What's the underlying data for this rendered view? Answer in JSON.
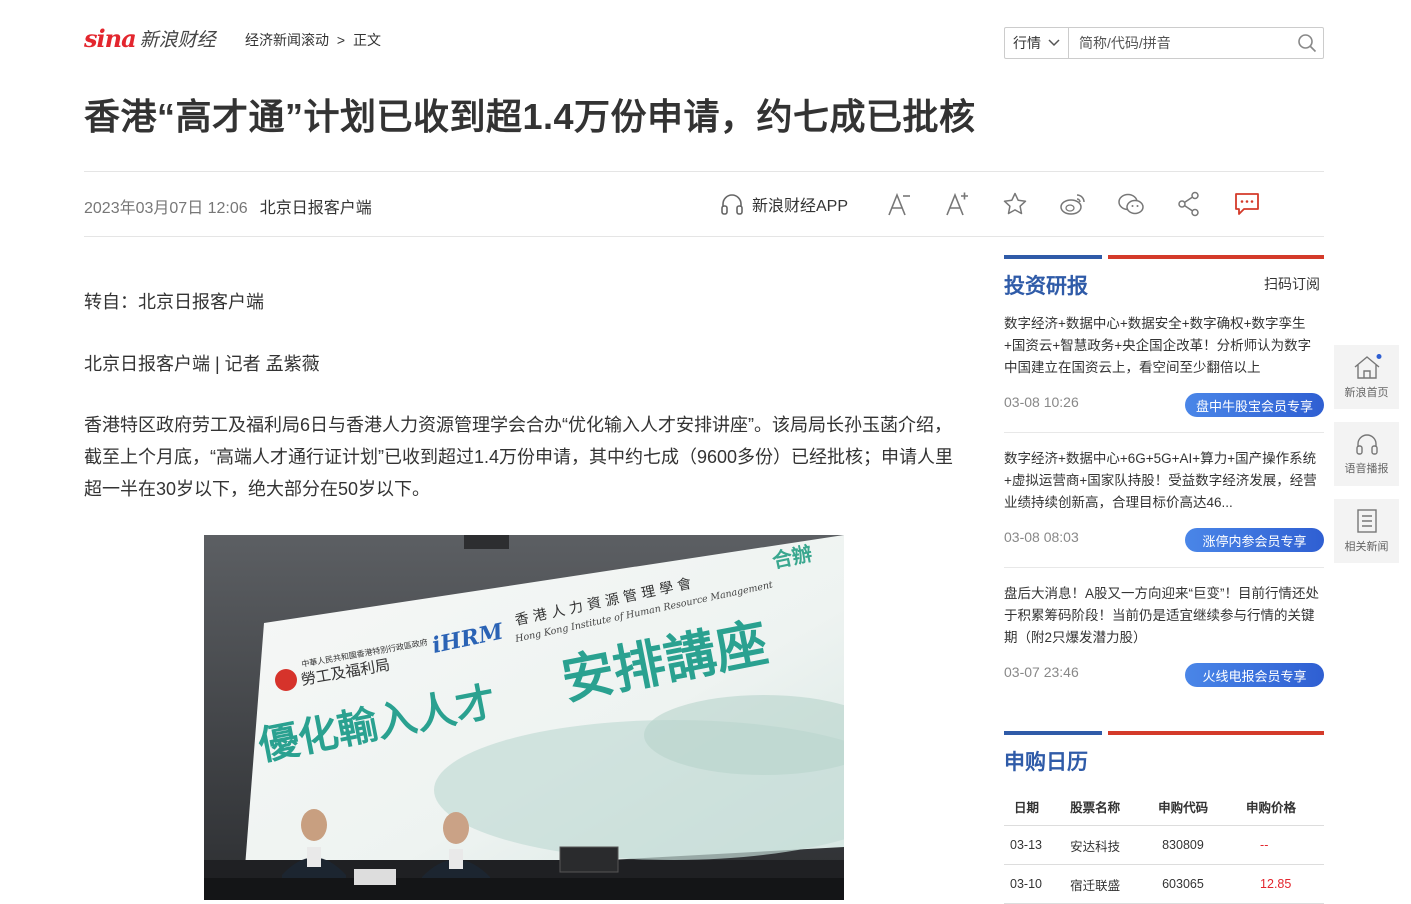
{
  "header": {
    "logo_sina": "sina",
    "logo_text": "新浪财经",
    "breadcrumb": [
      "经济新闻滚动",
      ">",
      "正文"
    ],
    "search_select": "行情",
    "search_placeholder": "简称/代码/拼音"
  },
  "article": {
    "title": "香港“高才通”计划已收到超1.4万份申请，约七成已批核",
    "date": "2023年03月07日 12:06",
    "source": "北京日报客户端",
    "app_label": "新浪财经APP",
    "p1": "转自：北京日报客户端",
    "p2": "北京日报客户端 | 记者 孟紫薇",
    "p3": "香港特区政府劳工及福利局6日与香港人力资源管理学会合办“优化输入人才安排讲座”。该局局长孙玉菡介绍，截至上个月底，“高端人才通行证计划”已收到超过1.4万份申请，其中约七成（9600多份）已经批核；申请人里超一半在30岁以下，绝大部分在50岁以下。",
    "photo": {
      "ihrm": "iHRM",
      "inst_cn": "香 港 人 力 資 源 管 理 學 會",
      "inst_en": "Hong Kong Institute of Human Resource Management",
      "co": "合辦",
      "gov": "中華人民共和國香港特別行政區政府",
      "bureau": "勞工及福利局",
      "banner_a": "優化輸入人才",
      "banner_b": "安排講座"
    }
  },
  "sidebar": {
    "research_title": "投资研报",
    "scan_label": "扫码订阅",
    "news": [
      {
        "text": "数字经济+数据中心+数据安全+数字确权+数字孪生+国资云+智慧政务+央企国企改革！分析师认为数字中国建立在国资云上，看空间至少翻倍以上",
        "date": "03-08 10:26",
        "tag": "盘中牛股宝会员专享"
      },
      {
        "text": "数字经济+数据中心+6G+5G+AI+算力+国产操作系统+虚拟运营商+国家队持股！受益数字经济发展，经营业绩持续创新高，合理目标价高达46...",
        "date": "03-08 08:03",
        "tag": "涨停内参会员专享"
      },
      {
        "text": "盘后大消息！A股又一方向迎来“巨变”！目前行情还处于积累筹码阶段！当前仍是适宜继续参与行情的关键期（附2只爆发潜力股）",
        "date": "03-07 23:46",
        "tag": "火线电报会员专享"
      }
    ],
    "ipo_title": "申购日历",
    "ipo_headers": [
      "日期",
      "股票名称",
      "申购代码",
      "申购价格"
    ],
    "ipo_rows": [
      [
        "03-13",
        "安达科技",
        "830809",
        "--"
      ],
      [
        "03-10",
        "宿迁联盛",
        "603065",
        "12.85"
      ]
    ]
  },
  "floatbar": [
    "新浪首页",
    "语音播报",
    "相关新闻"
  ],
  "colors": {
    "brand_red": "#e3262e",
    "accent_blue": "#2f5ba8",
    "button_blue": "#3a6fdc"
  }
}
